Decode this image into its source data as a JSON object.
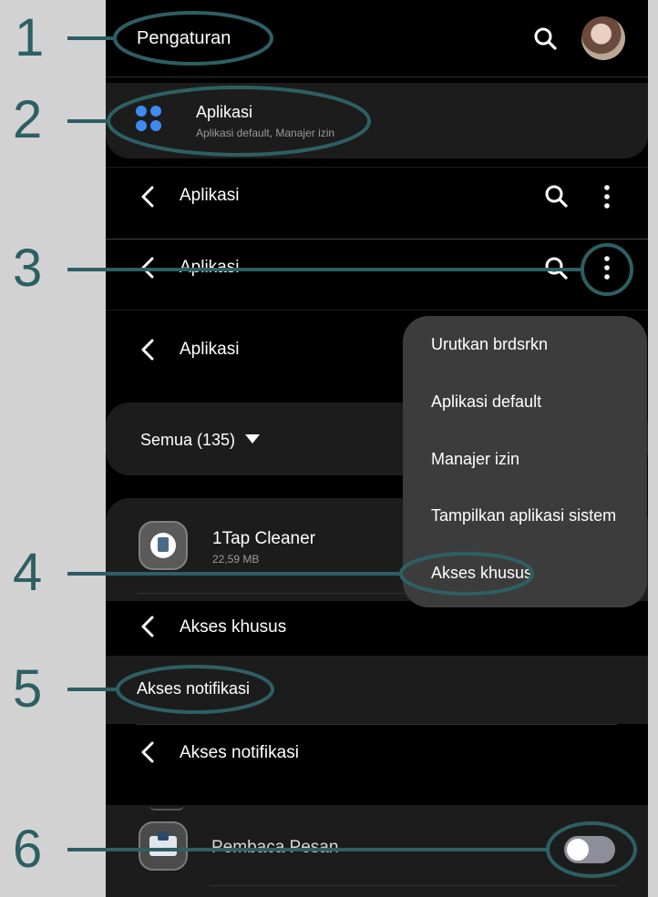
{
  "settings": {
    "title": "Pengaturan"
  },
  "apps_entry": {
    "title": "Aplikasi",
    "subtitle": "Aplikasi default, Manajer izin"
  },
  "apps_header": {
    "title": "Aplikasi"
  },
  "apps_header2": {
    "title": "Aplikasi"
  },
  "apps_header3": {
    "title": "Aplikasi"
  },
  "filter": {
    "label": "Semua (135)"
  },
  "app_item": {
    "name": "1Tap Cleaner",
    "size": "22,59 MB"
  },
  "menu": {
    "items": [
      "Urutkan brdsrkn",
      "Aplikasi default",
      "Manajer izin",
      "Tampilkan aplikasi sistem",
      "Akses khusus"
    ]
  },
  "special_header": {
    "title": "Akses khusus"
  },
  "notif_access": {
    "label": "Akses notifikasi"
  },
  "notif_header": {
    "title": "Akses notifikasi"
  },
  "reader_app": {
    "name": "Pembaca Pesan",
    "enabled": false
  },
  "steps": [
    "1",
    "2",
    "3",
    "4",
    "5",
    "6"
  ],
  "colors": {
    "annotation": "#2d5f63",
    "background": "#000000",
    "panel": "#1c1c1c",
    "menu": "#3c3c3c",
    "accent_blue": "#3d8bf0"
  }
}
